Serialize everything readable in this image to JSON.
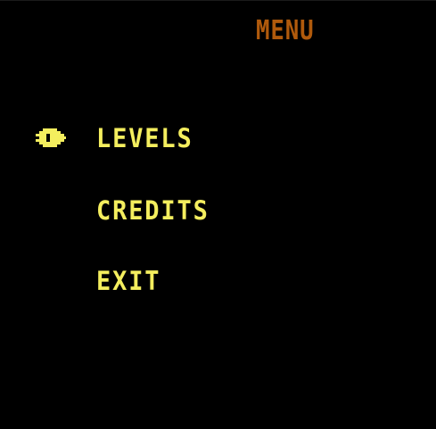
{
  "screen": {
    "title": "MENU",
    "menu_items": [
      {
        "id": "levels",
        "label": "LEVELS",
        "selected": true
      },
      {
        "id": "credits",
        "label": "CREDITS",
        "selected": false
      },
      {
        "id": "exit",
        "label": "EXIT",
        "selected": false
      }
    ],
    "cursor_icon": "pacman-face-icon"
  },
  "colors": {
    "background": "#000000",
    "title": "#b05a0c",
    "menu_text": "#f4ee5e",
    "cursor": "#f4ee5e"
  }
}
